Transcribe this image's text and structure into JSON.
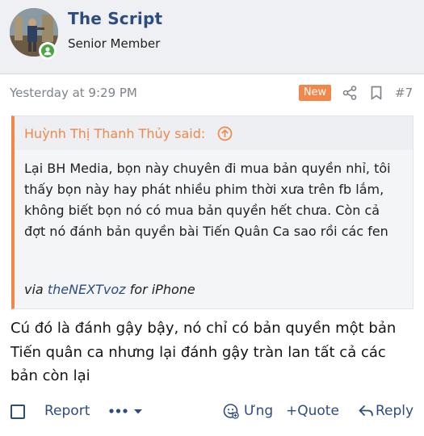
{
  "user": {
    "name": "The Script",
    "title": "Senior Member"
  },
  "post": {
    "timestamp": "Yesterday at 9:29 PM",
    "new_badge": "New",
    "number": "#7"
  },
  "quote": {
    "author": "Huỳnh Thị Thanh Thủy said:",
    "text": "Lại BH Media, bọn này chuyên đi mua bản quyền nhỉ, tôi thấy bọn này hay phát nhiều phim thời xưa trên fb lắm, không biết bọn nó có mua bản quyền hết chưa. Còn cả đợt nó đánh bản quyền bài Tiến Quân Ca sao rồi các fen",
    "signature_prefix": "via",
    "signature_link": "theNEXTvoz",
    "signature_suffix": "for iPhone"
  },
  "reply": {
    "text": "Cú đó là đánh gậy bậy, nó chỉ có bản quyền một bản Tiến quân ca nhưng lại đánh gậy tràn lan tất cả các bản còn lại"
  },
  "actions": {
    "report": "Report",
    "react": "Ưng",
    "quote": "+Quote",
    "reply": "Reply"
  },
  "icons": [
    "avatar",
    "online-badge-icon",
    "share-icon",
    "bookmark-icon",
    "arrow-up-circle-icon",
    "checkbox-icon",
    "more-dots-icon",
    "chevron-down-icon",
    "react-smile-icon",
    "reply-arrow-icon"
  ],
  "colors": {
    "accent_orange": "#f2874a",
    "link_blue": "#2c4c82",
    "online_green": "#46a640",
    "header_bg": "#eef0f3"
  }
}
